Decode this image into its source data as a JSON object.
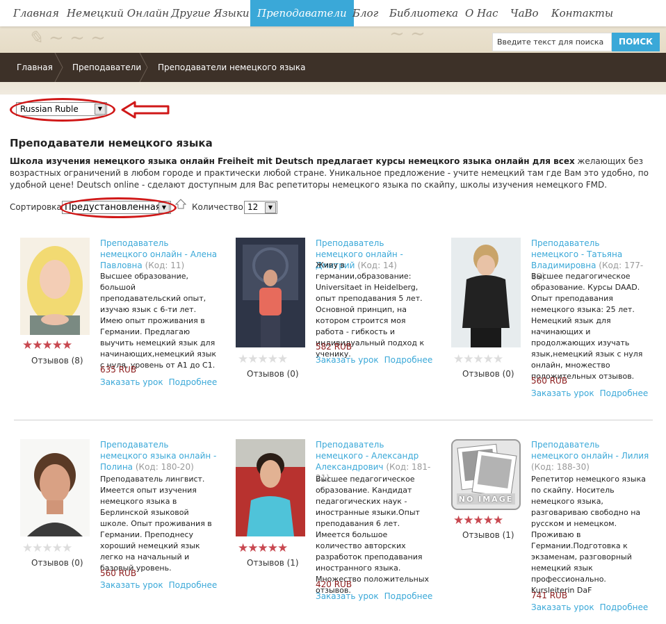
{
  "nav": [
    {
      "label": "Главная",
      "active": false
    },
    {
      "label": "Немецкий Онлайн",
      "active": false
    },
    {
      "label": "Другие Языки",
      "active": false
    },
    {
      "label": "Преподаватели",
      "active": true
    },
    {
      "label": "Блог",
      "active": false
    },
    {
      "label": "Библиотека",
      "active": false
    },
    {
      "label": "О Нас",
      "active": false
    },
    {
      "label": "ЧаВо",
      "active": false
    },
    {
      "label": "Контакты",
      "active": false
    }
  ],
  "search": {
    "placeholder": "Введите текст для поиска",
    "button_label": "ПОИСК"
  },
  "breadcrumb": [
    "Главная",
    "Преподаватели",
    "Преподаватели немецкого языка"
  ],
  "currency": {
    "selected": "Russian Ruble"
  },
  "page_title": "Преподаватели немецкого языка",
  "intro": {
    "bold": "Школа изучения немецкого языка онлайн Freiheit mit Deutsch предлагает курсы немецкого языка онлайн для всех",
    "rest": " желающих без возрастных ограничений в любом городе и практически любой стране. Уникальное предложение - учите немецкий там где Вам это удобно, по удобной цене! Deutsch online - сделают доступным для Вас репетиторы немецкого языка по скайпу, школы изучения немецкого FMD."
  },
  "sort": {
    "label": "Сортировка:",
    "selected": "Предустановленная",
    "qty_label": "Количество:",
    "qty_selected": "12"
  },
  "colors": {
    "accent": "#3aa8d8",
    "price": "#8b1a1a",
    "star": "#c84850",
    "breadcrumb_bg": "#3d3128",
    "annotation": "#d01818"
  },
  "teachers": [
    {
      "title": "Преподаватель немецкого онлайн - Алена Павловна",
      "code": "(Код: 11)",
      "desc": "Высшее образование, большой преподавательский опыт, изучаю язык с 6-ти лет. Имею опыт проживания в Германии. Предлагаю выучить немецкий язык для начинающих,немецкий язык с нуля, уровень от А1 до С1.",
      "price": "635 RUB",
      "rating": 5,
      "reviews": "Отзывов (8)",
      "order": "Заказать урок",
      "more": "Подробнее"
    },
    {
      "title": "Преподаватель немецкого онлайн - Дмитрий",
      "code": "(Код: 14)",
      "desc": "Живу в германии,образование: Universitaet in Heidelberg, опыт преподавания 5 лет. Основной принцип, на котором строится моя работа - гибкость и индивидуальный подход к ученику.",
      "price": "582 RUB",
      "rating": 0,
      "reviews": "Отзывов (0)",
      "order": "Заказать урок",
      "more": "Подробнее"
    },
    {
      "title": "Преподаватель немецкого - Татьяна Владимировна",
      "code": "(Код: 177-18)",
      "desc": "Высшее педагогическое образование. Курсы DAAD. Опыт преподавания немецкого языка: 25 лет. Немецкий язык для начинающих и продолжающих изучать язык,немецкий язык с нуля онлайн, множество положительных отзывов.",
      "price": "560 RUB",
      "rating": 0,
      "reviews": "Отзывов (0)",
      "order": "Заказать урок",
      "more": "Подробнее"
    },
    {
      "title": "Преподаватель немецкого языка онлайн - Полина",
      "code": "(Код: 180-20)",
      "desc": "Преподаватель лингвист. Имеется опыт изучения немецкого языка в Берлинской языковой школе. Опыт проживания в Германии. Преподнесу хороший немецкий язык легко на начальный и базовый уровень.",
      "price": "560 RUB",
      "rating": 0,
      "reviews": "Отзывов (0)",
      "order": "Заказать урок",
      "more": "Подробнее"
    },
    {
      "title": "Преподаватель немецкого - Александр Александрович",
      "code": "(Код: 181-21)",
      "desc": "Высшее педагогическое образование. Кандидат педагогических наук - иностранные языки.Опыт преподавания 6 лет. Имеется большое количество авторских разработок преподавания иностранного языка. Множество положительных отзывов.",
      "price": "420 RUB",
      "rating": 5,
      "reviews": "Отзывов (1)",
      "order": "Заказать урок",
      "more": "Подробнее"
    },
    {
      "title": "Преподаватель немецкого онлайн - Лилия",
      "code": "(Код: 188-30)",
      "desc": "Репетитор немецкого языка по скайпу. Носитель немецкого языка, разговариваю свободно на русском и немецком. Проживаю в Германии.Подготовка к экзаменам, разговорный немецкий язык профессионально. Kursleiterin DaF",
      "price": "741 RUB",
      "rating": 5,
      "reviews": "Отзывов (1)",
      "order": "Заказать урок",
      "more": "Подробнее",
      "no_image_label": "NO IMAGE"
    }
  ]
}
